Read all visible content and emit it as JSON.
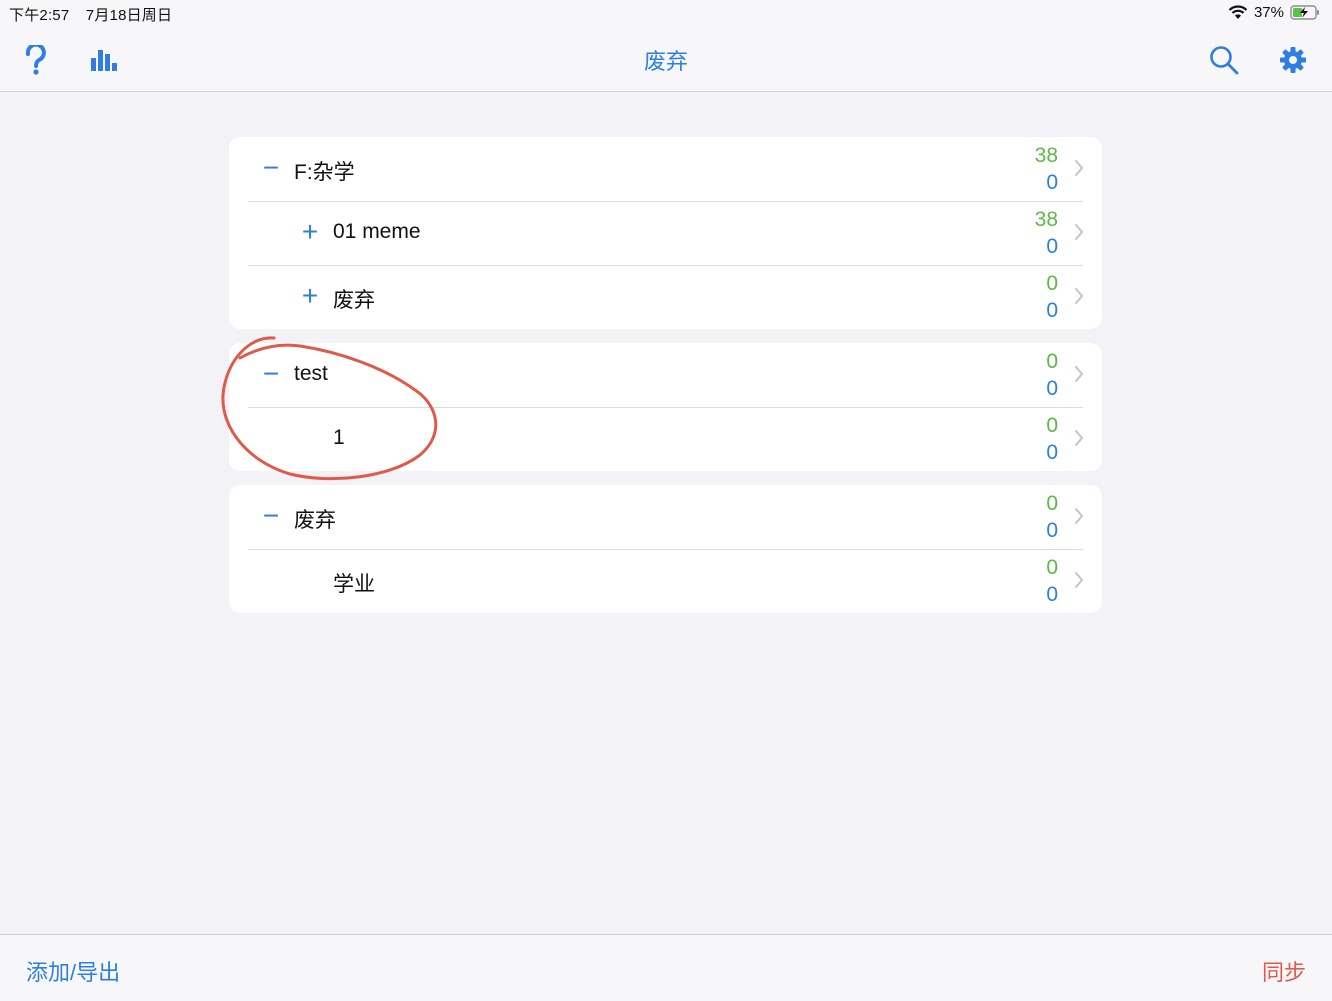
{
  "status_bar": {
    "time": "下午2:57",
    "date": "7月18日周日",
    "battery": "37%"
  },
  "nav": {
    "title": "废弃",
    "icons": [
      "help-icon",
      "stats-icon",
      "search-icon",
      "settings-icon"
    ]
  },
  "groups": [
    {
      "rows": [
        {
          "expander": "−",
          "name": "F:杂学",
          "new": "38",
          "due": "0"
        },
        {
          "expander": "+",
          "name": "01 meme",
          "new": "38",
          "due": "0"
        },
        {
          "expander": "+",
          "name": "废弃",
          "new": "0",
          "due": "0"
        }
      ]
    },
    {
      "rows": [
        {
          "expander": "−",
          "name": "test",
          "new": "0",
          "due": "0"
        },
        {
          "expander": "",
          "name": "1",
          "new": "0",
          "due": "0"
        }
      ]
    },
    {
      "rows": [
        {
          "expander": "−",
          "name": "废弃",
          "new": "0",
          "due": "0"
        },
        {
          "expander": "",
          "name": "学业",
          "new": "0",
          "due": "0"
        }
      ]
    }
  ],
  "bottom_bar": {
    "left": "添加/导出",
    "right": "同步"
  },
  "colors": {
    "accent": "#2f7ee0",
    "new_count": "#5cb84a",
    "sync": "#e05a4a",
    "annotation": "#e05a4a"
  }
}
